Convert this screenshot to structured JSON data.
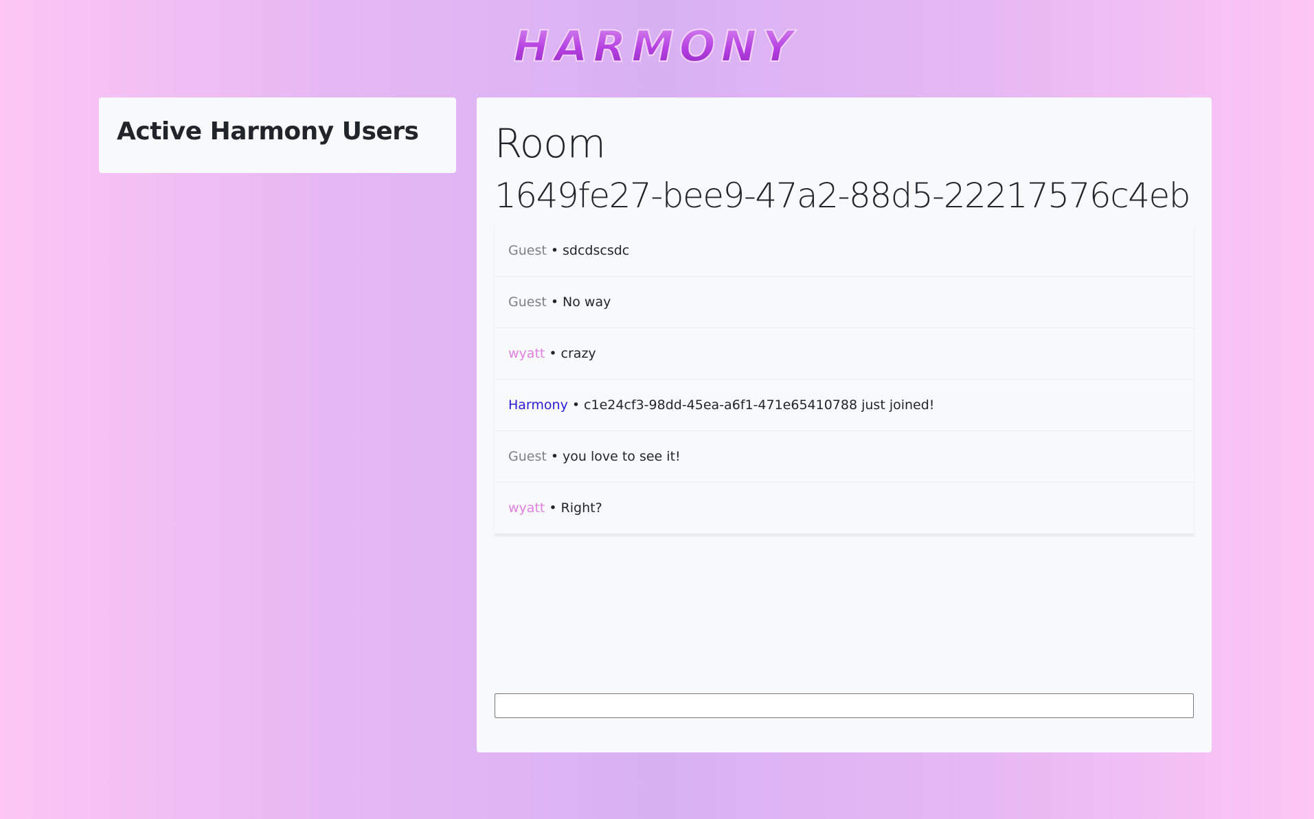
{
  "app": {
    "logo_text": "HARMONY"
  },
  "colors": {
    "background_edge": "#fdc6f4",
    "background_center": "#d8b1f3",
    "panel": "#f8f9fa",
    "guest_name": "#808080",
    "user_name": "#e07fe0",
    "system_name": "#2a1ad8",
    "logo": "#b53fe0"
  },
  "users_panel": {
    "title": "Active Harmony Users",
    "users": []
  },
  "room": {
    "heading": "Room",
    "id": "1649fe27-bee9-47a2-88d5-22217576c4eb",
    "messages": [
      {
        "user": "Guest",
        "user_color": "#808080",
        "separator": "•",
        "text": "sdcdscsdc"
      },
      {
        "user": "Guest",
        "user_color": "#808080",
        "separator": "•",
        "text": "No way"
      },
      {
        "user": "wyatt",
        "user_color": "#e07fe0",
        "separator": "•",
        "text": "crazy"
      },
      {
        "user": "Harmony",
        "user_color": "#2a1ad8",
        "separator": "•",
        "text": "c1e24cf3-98dd-45ea-a6f1-471e65410788 just joined!"
      },
      {
        "user": "Guest",
        "user_color": "#808080",
        "separator": "•",
        "text": "you love to see it!"
      },
      {
        "user": "wyatt",
        "user_color": "#e07fe0",
        "separator": "•",
        "text": "Right?"
      }
    ],
    "input": {
      "value": "",
      "placeholder": ""
    }
  }
}
